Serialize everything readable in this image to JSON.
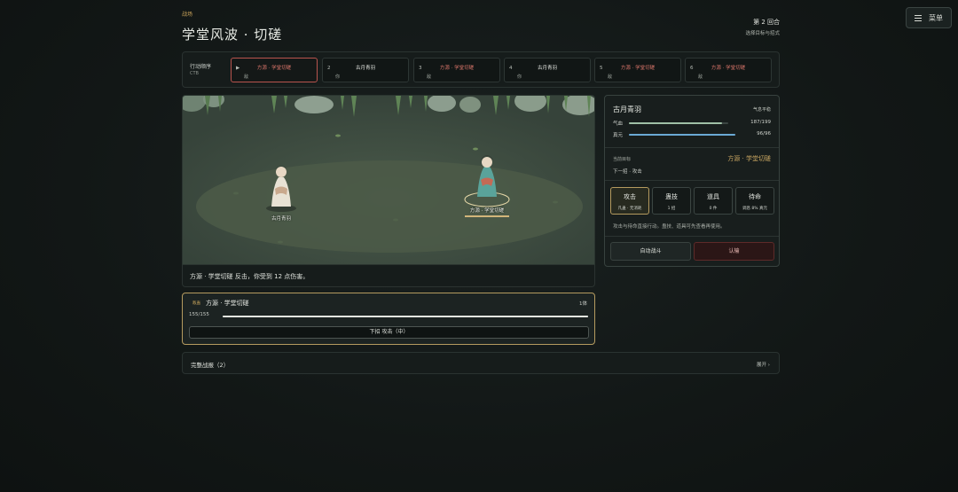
{
  "menu": {
    "label": "菜单"
  },
  "header": {
    "breadcrumb": "战场",
    "title": "学堂风波 · 切磋",
    "round": "第 2 回合",
    "round_hint": "选择目标与招式"
  },
  "turn_order": {
    "label": "行动顺序",
    "sub": "CTB",
    "slots": [
      {
        "index": "▶",
        "name": "方源 · 学堂切磋",
        "side": "敌",
        "team": "enemy",
        "active": true
      },
      {
        "index": "2",
        "name": "古月青羽",
        "side": "你",
        "team": "ally",
        "active": false
      },
      {
        "index": "3",
        "name": "方源 · 学堂切磋",
        "side": "敌",
        "team": "enemy",
        "active": false
      },
      {
        "index": "4",
        "name": "古月青羽",
        "side": "你",
        "team": "ally",
        "active": false
      },
      {
        "index": "5",
        "name": "方源 · 学堂切磋",
        "side": "敌",
        "team": "enemy",
        "active": false
      },
      {
        "index": "6",
        "name": "方源 · 学堂切磋",
        "side": "敌",
        "team": "enemy",
        "active": false
      }
    ]
  },
  "field": {
    "player_name": "古月青羽",
    "enemy_name": "方源 · 学堂切磋",
    "enemy_hp_fraction": 1.0
  },
  "log": {
    "text": "方源 · 学堂切磋 反击，你受到 12 点伤害。"
  },
  "target_card": {
    "tag": "敌蛊",
    "name": "方源 · 学堂切磋",
    "count": "1体",
    "hp_text": "155/155",
    "hp_fraction": 1.0,
    "intent": "下招 攻击（中）"
  },
  "report": {
    "label": "完整战报（2）",
    "expand": "展开 ›"
  },
  "panel": {
    "name": "古月青羽",
    "stance": "气息平稳",
    "hp_label": "气血",
    "hp_value": "187/199",
    "hp_fraction": 0.94,
    "hp_color": "#9fc0a6",
    "mp_label": "真元",
    "mp_value": "96/96",
    "mp_fraction": 1.0,
    "mp_color": "#6aa9d4",
    "current_label": "当前目标",
    "current_target": "方源 · 学堂切磋",
    "next_action": "下一招 · 攻击",
    "actions": [
      {
        "label": "攻击",
        "sub": "凡蛊 · 无消耗",
        "selected": true
      },
      {
        "label": "蛊技",
        "sub": "1 招",
        "selected": false
      },
      {
        "label": "道具",
        "sub": "0 件",
        "selected": false
      },
      {
        "label": "待命",
        "sub": "调息 8% 真元",
        "selected": false
      }
    ],
    "hint": "攻击与待命直接行动。蛊技、道具可先查看再使用。",
    "auto_label": "自动战斗",
    "flee_label": "认输"
  },
  "colors": {
    "accent_gold": "#c7a561",
    "enemy_red": "#d9756a",
    "danger_border": "#5e2a29"
  }
}
